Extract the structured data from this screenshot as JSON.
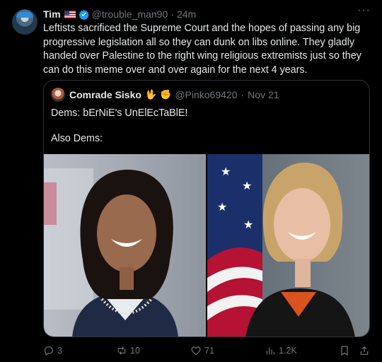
{
  "tweet": {
    "author_name": "Tim",
    "handle": "@trouble_man90",
    "separator": "·",
    "time": "24m",
    "text": "Leftists sacrificed the Supreme Court and the hopes of passing any big progressive legislation all so they can dunk on libs online. They gladly handed over Palestine to the right wing religious extremists just so they can do this meme over and over again for the next 4 years.",
    "more_label": "···"
  },
  "quote": {
    "author_name": "Comrade Sisko",
    "emoji1": "🖖",
    "emoji2": "✊",
    "handle": "@Pinko69420",
    "separator": "·",
    "date": "Nov 21",
    "line1": "Dems: bErNiE's UnElEcTaBlE!",
    "line2": "Also Dems:"
  },
  "actions": {
    "replies": "3",
    "reposts": "10",
    "likes": "71",
    "views": "1.2K"
  },
  "colors": {
    "background": "#000000",
    "text": "#e7e9ea",
    "muted": "#71767b",
    "verified": "#1d9bf0",
    "border": "#2f3336"
  }
}
